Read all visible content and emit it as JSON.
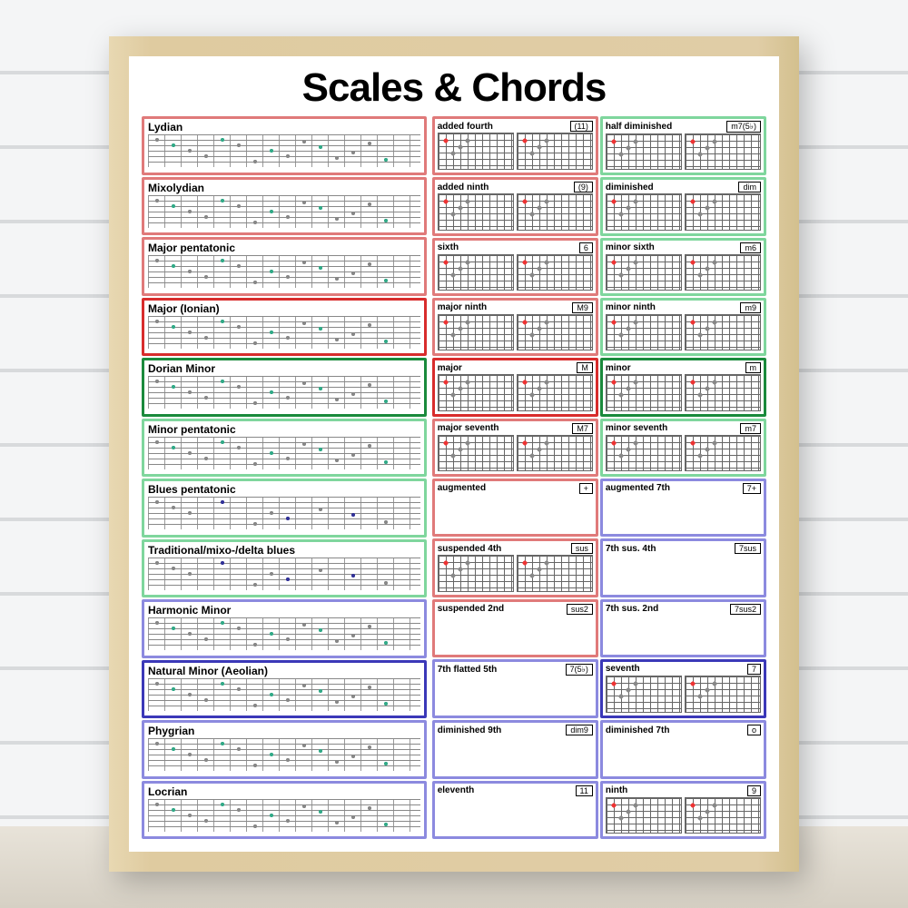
{
  "title": "Scales & Chords",
  "colors": {
    "red": "#e07a7a",
    "red_bold": "#d82c2c",
    "green": "#7fd69d",
    "green_bold": "#1a8a3c",
    "purple": "#8c8adf",
    "purple_bold": "#3b38b8"
  },
  "scales": [
    {
      "name": "Lydian",
      "color": "red",
      "blues": false
    },
    {
      "name": "Mixolydian",
      "color": "red",
      "blues": false
    },
    {
      "name": "Major pentatonic",
      "color": "red",
      "blues": false
    },
    {
      "name": "Major (Ionian)",
      "color": "red_bold",
      "blues": false
    },
    {
      "name": "Dorian Minor",
      "color": "green_bold",
      "blues": false
    },
    {
      "name": "Minor pentatonic",
      "color": "green",
      "blues": false
    },
    {
      "name": "Blues pentatonic",
      "color": "green",
      "blues": true
    },
    {
      "name": "Traditional/mixo-/delta blues",
      "color": "green",
      "blues": true
    },
    {
      "name": "Harmonic Minor",
      "color": "purple",
      "blues": false
    },
    {
      "name": "Natural Minor (Aeolian)",
      "color": "purple_bold",
      "blues": false
    },
    {
      "name": "Phygrian",
      "color": "purple",
      "blues": false
    },
    {
      "name": "Locrian",
      "color": "purple",
      "blues": false
    }
  ],
  "chords": [
    {
      "name": "added fourth",
      "sym": "(11)",
      "color": "red",
      "empty": false
    },
    {
      "name": "half diminished",
      "sym": "m7(5♭)",
      "color": "green",
      "empty": false
    },
    {
      "name": "added ninth",
      "sym": "(9)",
      "color": "red",
      "empty": false
    },
    {
      "name": "diminished",
      "sym": "dim",
      "color": "green",
      "empty": false
    },
    {
      "name": "sixth",
      "sym": "6",
      "color": "red",
      "empty": false
    },
    {
      "name": "minor sixth",
      "sym": "m6",
      "color": "green",
      "empty": false
    },
    {
      "name": "major ninth",
      "sym": "M9",
      "color": "red",
      "empty": false
    },
    {
      "name": "minor ninth",
      "sym": "m9",
      "color": "green",
      "empty": false
    },
    {
      "name": "major",
      "sym": "M",
      "color": "red_bold",
      "empty": false
    },
    {
      "name": "minor",
      "sym": "m",
      "color": "green_bold",
      "empty": false
    },
    {
      "name": "major seventh",
      "sym": "M7",
      "color": "red",
      "empty": false
    },
    {
      "name": "minor seventh",
      "sym": "m7",
      "color": "green",
      "empty": false
    },
    {
      "name": "augmented",
      "sym": "+",
      "color": "red",
      "empty": true
    },
    {
      "name": "augmented 7th",
      "sym": "7+",
      "color": "purple",
      "empty": true
    },
    {
      "name": "suspended 4th",
      "sym": "sus",
      "color": "red",
      "empty": false
    },
    {
      "name": "7th sus. 4th",
      "sym": "7sus",
      "color": "purple",
      "empty": true
    },
    {
      "name": "suspended 2nd",
      "sym": "sus2",
      "color": "red",
      "empty": true
    },
    {
      "name": "7th sus. 2nd",
      "sym": "7sus2",
      "color": "purple",
      "empty": true
    },
    {
      "name": "7th flatted 5th",
      "sym": "7(5♭)",
      "color": "purple",
      "empty": true
    },
    {
      "name": "seventh",
      "sym": "7",
      "color": "purple_bold",
      "empty": false
    },
    {
      "name": "diminished 9th",
      "sym": "dim9",
      "color": "purple",
      "empty": true
    },
    {
      "name": "diminished 7th",
      "sym": "o",
      "color": "purple",
      "empty": true
    },
    {
      "name": "eleventh",
      "sym": "11",
      "color": "purple",
      "empty": true
    },
    {
      "name": "ninth",
      "sym": "9",
      "color": "purple",
      "empty": false
    }
  ]
}
